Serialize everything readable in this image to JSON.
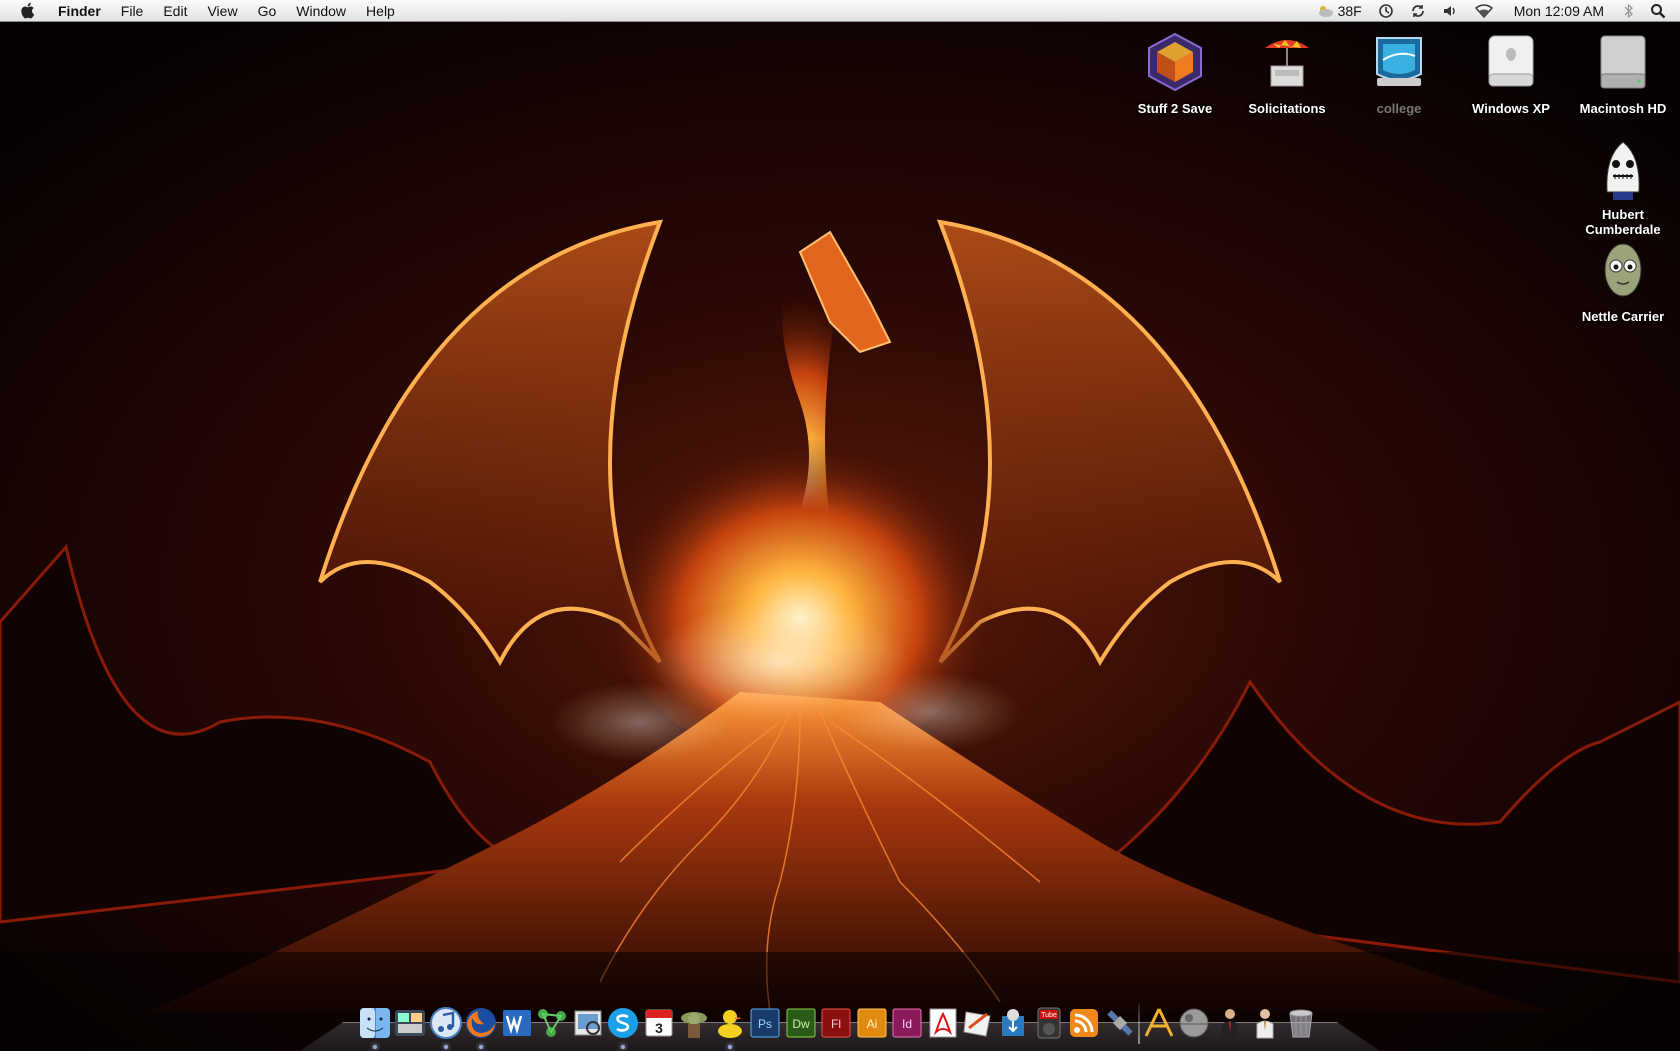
{
  "menubar": {
    "app_name": "Finder",
    "items": [
      "File",
      "Edit",
      "View",
      "Go",
      "Window",
      "Help"
    ],
    "status": {
      "weather": "38F",
      "clock": "Mon 12:09 AM"
    },
    "icons": [
      "apple-icon",
      "weather-icon",
      "time-machine-icon",
      "sync-icon",
      "volume-icon",
      "wifi-icon",
      "bluetooth-icon",
      "spotlight-icon"
    ]
  },
  "desktop": {
    "icons": [
      {
        "label": "Stuff 2 Save",
        "icon": "cube-folder-icon"
      },
      {
        "label": "Solicitations",
        "icon": "vendor-cart-icon"
      },
      {
        "label": "college",
        "icon": "network-drive-icon"
      },
      {
        "label": "Windows XP",
        "icon": "external-drive-icon"
      },
      {
        "label": "Macintosh HD",
        "icon": "hard-drive-icon"
      },
      {
        "label": "Hubert Cumberdale",
        "icon": "hubert-character-icon"
      },
      {
        "label": "Nettle Carrier",
        "icon": "nettle-character-icon"
      }
    ]
  },
  "dock": {
    "items": [
      "Finder",
      "Dashboard",
      "iTunes",
      "Firefox",
      "Word",
      "Network",
      "Preview",
      "Skype",
      "iCal",
      "Yoda",
      "Adium",
      "Photoshop",
      "Dreamweaver",
      "Flash",
      "Illustrator",
      "InDesign",
      "Acrobat",
      "Sketch",
      "Safari Downloader",
      "Tube",
      "RSS",
      "Satellite",
      "Xcode",
      "Death Star",
      "Person",
      "Dwight",
      "Trash"
    ],
    "labels": {
      "ical_day": "3",
      "ps": "Ps",
      "dw": "Dw",
      "fl": "Fl",
      "ai": "Ai",
      "id": "Id",
      "tube": "Tube"
    }
  }
}
